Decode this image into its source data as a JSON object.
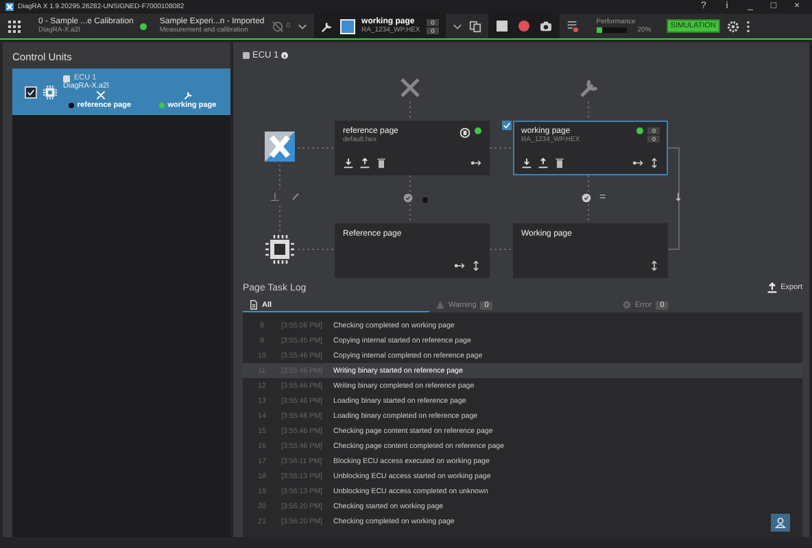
{
  "window": {
    "title": "DiagRA X 1.9.20295.26282-UNSIGNED-F7000108082",
    "controls": [
      "?",
      "i",
      "_",
      "□",
      "×"
    ]
  },
  "toolbar": {
    "project": {
      "name": "0 - Sample ...e Calibration",
      "file": "DiagRA-X.a2l"
    },
    "experiment": {
      "name": "Sample Experi...n - Imported",
      "subtitle": "Measurement and calibration"
    },
    "disconnected_count": "0",
    "page": {
      "name": "working page",
      "file": "RA_1234_WP.HEX",
      "counters": [
        "0",
        "0"
      ]
    },
    "performance": {
      "label": "Performance",
      "level": 0.2,
      "reading": "20%"
    },
    "mode": "SIMULATION"
  },
  "sidebar": {
    "title": "Control Units",
    "items": [
      {
        "name": "ECU 1",
        "file": "DiagRA-X.a2l",
        "checked": true,
        "selected": true,
        "pages": [
          {
            "label": "reference page",
            "color": "#111111"
          },
          {
            "label": "working page",
            "color": "#3ec93e"
          }
        ]
      }
    ]
  },
  "ecu": {
    "title": "ECU 1",
    "cards": [
      {
        "title": "reference page",
        "file": "default.hex",
        "selected": false,
        "checked": false
      },
      {
        "title": "working page",
        "file": "RA_1234_WP.HEX",
        "selected": true,
        "checked": true,
        "counters": [
          "0",
          "0"
        ]
      },
      {
        "title": "Reference page",
        "selected": false,
        "checked": false
      },
      {
        "title": "Working page",
        "selected": false,
        "checked": false
      }
    ],
    "compare": "="
  },
  "log": {
    "title": "Page Task Log",
    "export": "Export",
    "tabs": [
      {
        "label": "All",
        "selected": true
      },
      {
        "label": "Warning",
        "count": "0",
        "selected": false
      },
      {
        "label": "Error",
        "count": "0",
        "selected": false
      }
    ],
    "rows": [
      {
        "n": "8",
        "time": "[3:55:06 PM]",
        "text": "Checking completed on working page",
        "selected": false
      },
      {
        "n": "9",
        "time": "[3:55:45 PM]",
        "text": "Copying internal started on reference page",
        "selected": false
      },
      {
        "n": "10",
        "time": "[3:55:46 PM]",
        "text": "Copying internal completed on reference page",
        "selected": false
      },
      {
        "n": "11",
        "time": "[3:55:46 PM]",
        "text": "Writing binary started on reference page",
        "selected": true
      },
      {
        "n": "12",
        "time": "[3:55:46 PM]",
        "text": "Writing binary completed on reference page",
        "selected": false
      },
      {
        "n": "13",
        "time": "[3:55:46 PM]",
        "text": "Loading binary started on reference page",
        "selected": false
      },
      {
        "n": "14",
        "time": "[3:55:46 PM]",
        "text": "Loading binary completed on reference page",
        "selected": false
      },
      {
        "n": "15",
        "time": "[3:55:46 PM]",
        "text": "Checking page content started on reference page",
        "selected": false
      },
      {
        "n": "16",
        "time": "[3:55:46 PM]",
        "text": "Checking page content completed on reference page",
        "selected": false
      },
      {
        "n": "17",
        "time": "[3:56:11 PM]",
        "text": "Blocking ECU access executed on working page",
        "selected": false
      },
      {
        "n": "18",
        "time": "[3:56:13 PM]",
        "text": "Unblocking ECU access started on working page",
        "selected": false
      },
      {
        "n": "19",
        "time": "[3:56:13 PM]",
        "text": "Unblocking ECU access completed on unknown",
        "selected": false
      },
      {
        "n": "20",
        "time": "[3:56:20 PM]",
        "text": "Checking started on working page",
        "selected": false
      },
      {
        "n": "21",
        "time": "[3:56:20 PM]",
        "text": "Checking completed on working page",
        "selected": false
      }
    ]
  }
}
